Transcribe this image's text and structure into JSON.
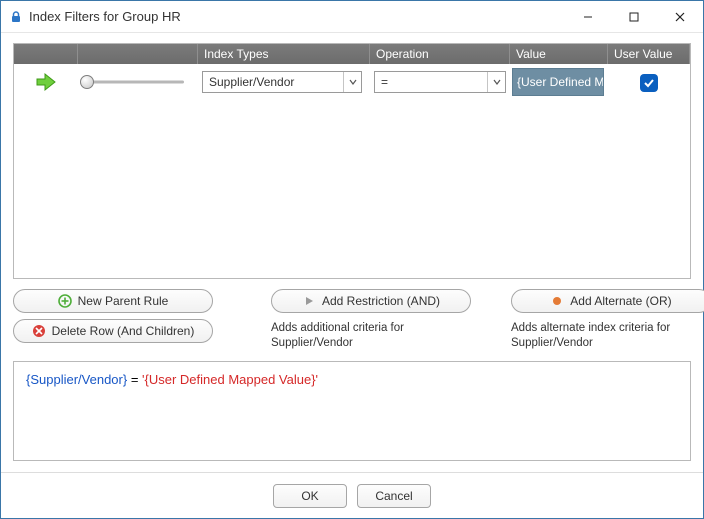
{
  "window": {
    "title": "Index Filters for Group HR"
  },
  "grid": {
    "headers": {
      "arrow": "",
      "slider": "",
      "types": "Index Types",
      "operation": "Operation",
      "value": "Value",
      "user_value": "User Value"
    },
    "row": {
      "index_type": "Supplier/Vendor",
      "operation": "=",
      "value": "{User Defined Ma...",
      "user_value_checked": true
    }
  },
  "buttons": {
    "new_parent": "New Parent Rule",
    "delete_row": "Delete Row (And Children)",
    "add_restriction": "Add Restriction (AND)",
    "add_alternate": "Add Alternate (OR)"
  },
  "helpers": {
    "restriction": "Adds additional criteria for Supplier/Vendor",
    "alternate": "Adds alternate index criteria for Supplier/Vendor"
  },
  "expression": {
    "lhs": "{Supplier/Vendor}",
    "op": " = ",
    "rhs": "'{User Defined Mapped Value}'"
  },
  "footer": {
    "ok": "OK",
    "cancel": "Cancel"
  }
}
